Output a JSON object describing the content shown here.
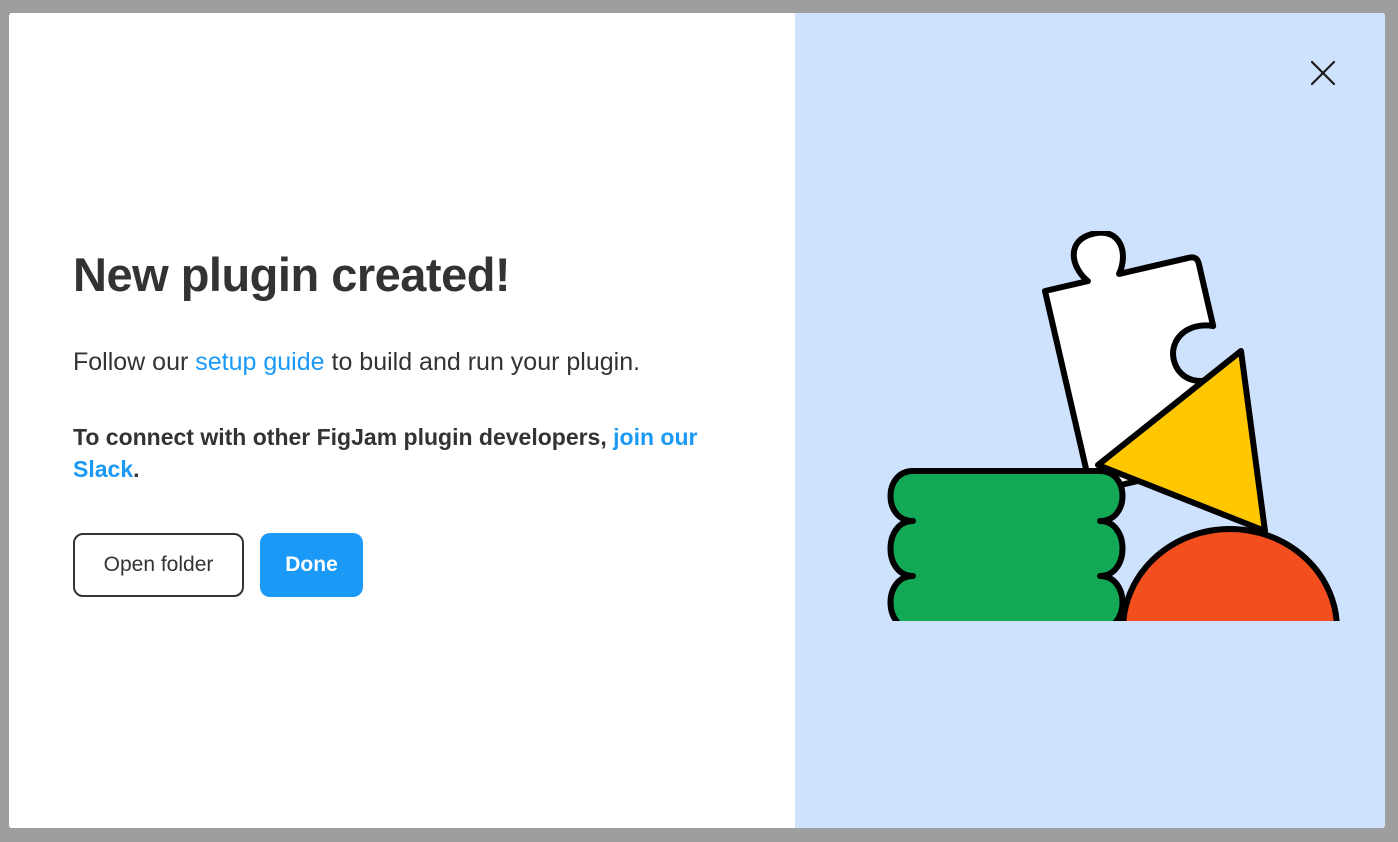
{
  "dialog": {
    "title": "New plugin created!",
    "intro_prefix": "Follow our ",
    "intro_link": "setup guide",
    "intro_suffix": " to build and run your plugin.",
    "community_prefix": "To connect with other FigJam plugin developers, ",
    "community_link": "join our Slack",
    "community_suffix": ".",
    "buttons": {
      "open_folder": "Open folder",
      "done": "Done"
    }
  },
  "colors": {
    "accent": "#1a99f7",
    "text": "#333333",
    "illustration_background": "#cfe2fd",
    "puzzle": "#ffffff",
    "stack": "#12a856",
    "triangle": "#ffc700",
    "semicircle": "#f24e1e"
  },
  "icons": {
    "close": "close-icon",
    "illustration": "puzzle-shapes-illustration"
  }
}
